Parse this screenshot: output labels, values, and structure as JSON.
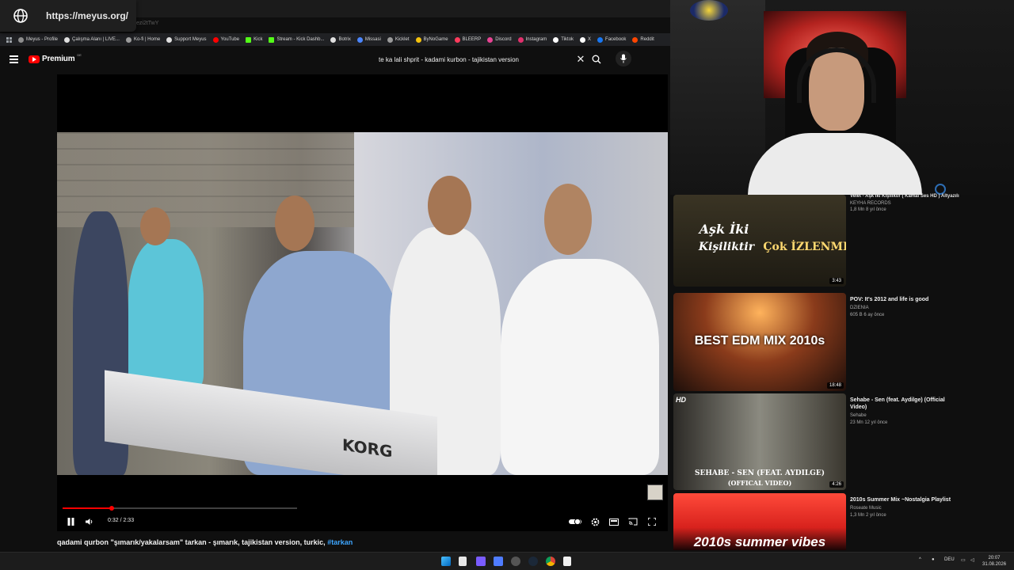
{
  "browser": {
    "url": "https://meyus.org/",
    "ghost_tab_text": "ezi2tTwY",
    "bookmarks": [
      {
        "label": "Meyus - Profile",
        "icon": "meyus-icon",
        "color": "#8e8e8e"
      },
      {
        "label": "Çalışma Alanı | LIVE...",
        "icon": "puzzle-icon",
        "color": "#e0e0e0"
      },
      {
        "label": "Ko-fi | Home",
        "icon": "kofi-icon",
        "color": "#9b9b9b"
      },
      {
        "label": "Support Meyus",
        "icon": "support-icon",
        "color": "#e0e0e0"
      },
      {
        "label": "YouTube",
        "icon": "youtube-icon",
        "color": "#ff0000"
      },
      {
        "label": "Kick",
        "icon": "kick-icon",
        "color": "#53fc18"
      },
      {
        "label": "Stream - Kick Dashb...",
        "icon": "kick-icon",
        "color": "#53fc18"
      },
      {
        "label": "Botrix",
        "icon": "botrix-icon",
        "color": "#e0e0e0"
      },
      {
        "label": "Missasi",
        "icon": "missasi-icon",
        "color": "#4b86ff"
      },
      {
        "label": "Kicklet",
        "icon": "kicklet-icon",
        "color": "#9b9b9b"
      },
      {
        "label": "ByNoGame",
        "icon": "bynogame-icon",
        "color": "#f4c20d"
      },
      {
        "label": "BLEERP",
        "icon": "bleerp-icon",
        "color": "#ff3b5c"
      },
      {
        "label": "Discord",
        "icon": "discord-icon",
        "color": "#e84393"
      },
      {
        "label": "Instagram",
        "icon": "instagram-icon",
        "color": "#e1306c"
      },
      {
        "label": "Tiktok",
        "icon": "tiktok-icon",
        "color": "#ffffff"
      },
      {
        "label": "X",
        "icon": "x-icon",
        "color": "#ffffff"
      },
      {
        "label": "Facebook",
        "icon": "facebook-icon",
        "color": "#1877f2"
      },
      {
        "label": "Reddit",
        "icon": "reddit-icon",
        "color": "#ff4500"
      }
    ]
  },
  "youtube": {
    "logo_word": "Premium",
    "region": "DE",
    "search_query": "te ka lali shprit - kadami kurbon - tajikistan version",
    "player": {
      "current_time": "0:32",
      "duration": "2:33",
      "time_display": "0:32 / 2:33",
      "progress_fraction": 0.209,
      "thumb_text": "KORG"
    },
    "video_title": "qadami qurbon \"şımarık/yakalarsam\" tarkan - şımarık, tajikistan version, turkic, ",
    "video_hashtag": "#tarkan",
    "recommendations_clip_top": {
      "title": "Velet - Aşk İki Kişiliktir ( Kamal Ses HD ) Altyazılı",
      "channel": "KEYHA RECORDS",
      "stats": "1,8 Mn  8 yıl önce"
    },
    "recommendations": [
      {
        "thumb_line1": "Aşk İki",
        "thumb_line2": "Kişiliktir",
        "thumb_line3": "Çok İZLENME",
        "duration": "3:43",
        "title": "",
        "channel": "",
        "stats": ""
      },
      {
        "thumb_text": "BEST EDM MIX 2010s",
        "duration": "18:48",
        "title": "POV: It's 2012 and life is good",
        "channel": "DZIENIA",
        "stats": "605 B  6 ay önce"
      },
      {
        "thumb_badge": "HD",
        "thumb_text": "SEHABE - SEN (FEAT. AYDILGE)",
        "thumb_text2": "(OFFICAL VIDEO)",
        "duration": "4:26",
        "title": "Sehabe - Sen (feat. Aydilge) (Official Video)",
        "channel": "Sehabe",
        "stats": "23 Mn  12 yıl önce"
      },
      {
        "thumb_text": "2010s summer vibes",
        "duration": "",
        "title": "2010s Summer Mix ~Nostalgia Playlist",
        "channel": "Roseate Music",
        "stats": "1,3 Mn  2 yıl önce"
      }
    ]
  },
  "taskbar": {
    "language": "DEU",
    "time": "20:07",
    "date": "31.08.2026"
  },
  "colors": {
    "accent": "#ff0000",
    "link": "#3ea6ff",
    "background": "#0f0f0f"
  }
}
